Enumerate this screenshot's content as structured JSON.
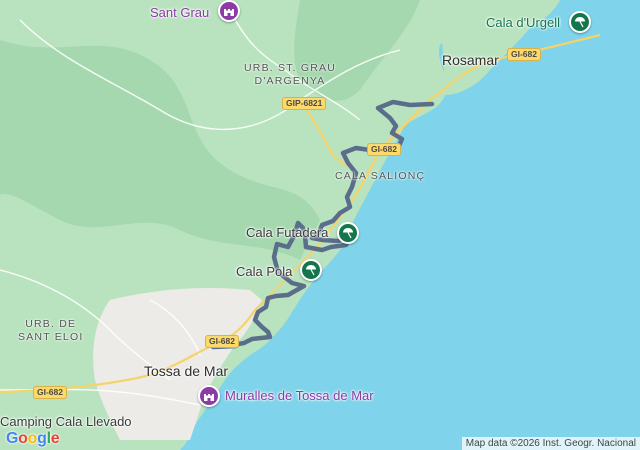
{
  "colors": {
    "sea": "#7fd3ea",
    "forest": "#b9e3bf",
    "forest_dark": "#a5d8ae",
    "urban": "#ecebe7",
    "route": "#5a6e8c",
    "poi_green": "#14764d",
    "poi_purple": "#8b3aa6",
    "shield": "#fbd96b"
  },
  "places": {
    "sant_grau": "Sant Grau",
    "urb_st_grau_l1": "URB. ST. GRAU",
    "urb_st_grau_l2": "D'ARGENYA",
    "rosamar": "Rosamar",
    "cala_urgell": "Cala d'Urgell",
    "cala_salionc": "CALA SALIONÇ",
    "cala_futadera": "Cala Futadera",
    "cala_pola": "Cala Pola",
    "urb_sant_eloi_l1": "URB. DE",
    "urb_sant_eloi_l2": "SANT ELOI",
    "tossa": "Tossa de Mar",
    "muralles": "Muralles de Tossa de Mar",
    "camping": "Camping Cala Llevado"
  },
  "roads": {
    "gip6821": "GIP-6821",
    "gi682_a": "GI-682",
    "gi682_b": "GI-682",
    "gi682_c": "GI-682",
    "gi682_d": "GI-682"
  },
  "icons": {
    "beach": "beach-umbrella-icon",
    "landmark": "castle-icon"
  },
  "footer": {
    "google_letters": [
      "G",
      "o",
      "o",
      "g",
      "l",
      "e"
    ],
    "attribution": "Map data ©2026 Inst. Geogr. Nacional"
  }
}
